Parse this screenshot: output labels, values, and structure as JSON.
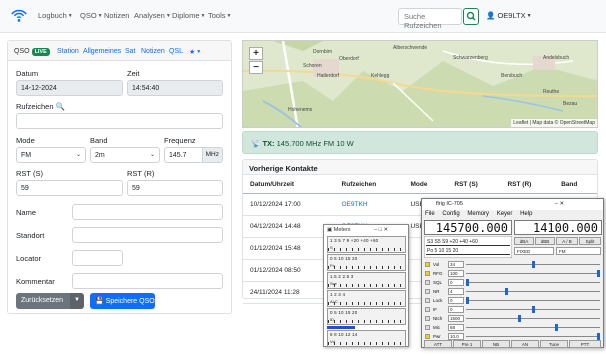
{
  "navbar": {
    "menus": [
      {
        "label": "Logbuch",
        "has_dropdown": true
      },
      {
        "label": "QSO",
        "has_dropdown": true
      },
      {
        "label": "Notizen",
        "has_dropdown": false
      },
      {
        "label": "Analysen",
        "has_dropdown": true
      },
      {
        "label": "Diplome",
        "has_dropdown": true
      },
      {
        "label": "Tools",
        "has_dropdown": true
      }
    ],
    "search_placeholder": "Suche Rufzeichen",
    "user": "OE9LTX"
  },
  "qso_card": {
    "tabs": [
      {
        "label": "QSO",
        "badge": "LIVE",
        "active": true
      },
      {
        "label": "Station"
      },
      {
        "label": "Allgemeines"
      },
      {
        "label": "Sat"
      },
      {
        "label": "Notizen"
      },
      {
        "label": "QSL"
      }
    ],
    "datum_label": "Datum",
    "datum_value": "14-12-2024",
    "zeit_label": "Zeit",
    "zeit_value": "14:54:40",
    "rufzeichen_label": "Rufzeichen",
    "rufzeichen_value": "",
    "mode_label": "Mode",
    "mode_value": "FM",
    "band_label": "Band",
    "band_value": "2m",
    "frequenz_label": "Frequenz",
    "frequenz_value": "145.7",
    "frequenz_unit": "MHz",
    "rst_s_label": "RST (S)",
    "rst_s_value": "59",
    "rst_r_label": "RST (R)",
    "rst_r_value": "59",
    "name_label": "Name",
    "standort_label": "Standort",
    "locator_label": "Locator",
    "kommentar_label": "Kommentar",
    "reset_label": "Zurücksetzen",
    "save_label": "Speichere QSO"
  },
  "map": {
    "towns": [
      "Dornbirn",
      "Oberdorf",
      "Schoren",
      "Hohenems",
      "Hatlerdorf",
      "Kehlegg",
      "Schwarzenberg",
      "Andelsbuch",
      "Bersbuch",
      "Bezau",
      "Reuthe",
      "Alberschwende"
    ],
    "attribution": "Leaflet | Map data © OpenStreetMap"
  },
  "tx_status": {
    "prefix": "TX:",
    "text": "145.700 MHz  FM  10 W"
  },
  "recent_contacts": {
    "title": "Vorherige Kontakte",
    "columns": [
      "Datum/Uhrzeit",
      "Rufzeichen",
      "Mode",
      "RST (S)",
      "RST (R)",
      "Band"
    ],
    "rows": [
      [
        "10/12/2024 17:00",
        "OE9TKH",
        "USB",
        "",
        "",
        ""
      ],
      [
        "04/12/2024 14:48",
        "OE9TKH",
        "USB",
        "",
        "",
        ""
      ],
      [
        "01/12/2024 15:48",
        "",
        "",
        "",
        "",
        ""
      ],
      [
        "01/12/2024 08:50",
        "",
        "",
        "",
        "",
        ""
      ],
      [
        "24/11/2024 11:28",
        "",
        "",
        "",
        "",
        ""
      ]
    ]
  },
  "meters_window": {
    "title": "Meters",
    "scales": [
      {
        "nums": "1  3  5  7  9 +20 +40 +60",
        "label": "S"
      },
      {
        "nums": "0   5   10   15   20",
        "label": "Po"
      },
      {
        "nums": "1.5  2  2.5  3",
        "label": "Swr"
      },
      {
        "nums": "1    2    3    4",
        "label": "ALC"
      },
      {
        "nums": "0   5   10   15   20",
        "label": "ID"
      },
      {
        "nums": "6  8  10  12  14",
        "label": "Vd"
      }
    ]
  },
  "rig_window": {
    "title": "flrig IC-705",
    "menus": [
      "File",
      "Config",
      "Memory",
      "Keyer",
      "Help"
    ],
    "freq_a": "145700.000",
    "freq_b": "14100.000",
    "vfo_buttons": [
      "dBA",
      "dBB",
      "A / B",
      "Split"
    ],
    "bandwidth": "FIXED",
    "mode": "FM",
    "controls": [
      {
        "label": "Vol",
        "value": "34",
        "level": 0.5
      },
      {
        "label": "RFG",
        "value": "100",
        "level": 1.0
      },
      {
        "label": "SQL",
        "value": "0",
        "level": 0.0
      },
      {
        "label": "NR",
        "value": "4",
        "level": 0.3
      },
      {
        "label": "Lock",
        "value": "0",
        "level": 0.0
      },
      {
        "label": "IF",
        "value": "0",
        "level": 0.5
      },
      {
        "label": "Ntch",
        "value": "1500",
        "level": 0.4
      },
      {
        "label": "Mic",
        "value": "68",
        "level": 0.68
      },
      {
        "label": "Pwr",
        "value": "10.0",
        "level": 1.0
      }
    ],
    "bottom_buttons": [
      "ATT",
      "Pre 1",
      "NB",
      "AN",
      "Tune",
      "PTT"
    ]
  }
}
